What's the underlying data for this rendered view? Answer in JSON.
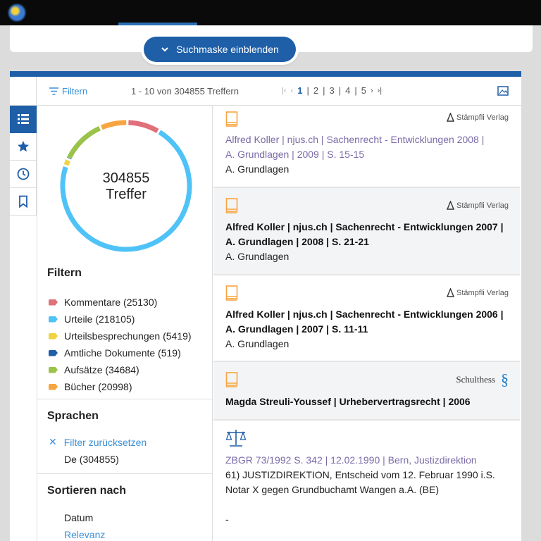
{
  "search_toggle": {
    "label": "Suchmaske einblenden"
  },
  "toolbar": {
    "filter_label": "Filtern",
    "hits_range": "1 - 10 von 304855 Treffern",
    "pages": [
      "1",
      "2",
      "3",
      "4",
      "5"
    ],
    "current_page": "1"
  },
  "summary": {
    "count": "304855",
    "count_label": "Treffer"
  },
  "filters": {
    "title": "Filtern",
    "items": [
      {
        "label": "Kommentare (25130)",
        "color": "#e0707a",
        "value": 25130
      },
      {
        "label": "Urteile (218105)",
        "color": "#4fc3f7",
        "value": 218105
      },
      {
        "label": "Urteilsbesprechungen (5419)",
        "color": "#f0d340",
        "value": 5419
      },
      {
        "label": "Amtliche Dokumente (519)",
        "color": "#1f5fa8",
        "value": 519
      },
      {
        "label": "Aufsätze (34684)",
        "color": "#9bc34a",
        "value": 34684
      },
      {
        "label": "Bücher (20998)",
        "color": "#f7a540",
        "value": 20998
      }
    ]
  },
  "languages": {
    "title": "Sprachen",
    "reset_label": "Filter zurücksetzen",
    "value": "De (304855)"
  },
  "sort": {
    "title": "Sortieren nach",
    "options": [
      "Datum",
      "Relevanz"
    ]
  },
  "results": [
    {
      "type": "book",
      "publisher": "Stämpfli Verlag",
      "title_line1": "Alfred Koller | njus.ch | Sachenrecht - Entwicklungen 2008 |",
      "title_line2": "A. Grundlagen | 2009 | S. 15-15",
      "subtitle": "A. Grundlagen"
    },
    {
      "type": "book",
      "publisher": "Stämpfli Verlag",
      "title_line1": "Alfred Koller | njus.ch | Sachenrecht - Entwicklungen 2007 |",
      "title_line2": "A. Grundlagen | 2008 | S. 21-21",
      "subtitle": "A. Grundlagen"
    },
    {
      "type": "book",
      "publisher": "Stämpfli Verlag",
      "title_line1": "Alfred Koller | njus.ch | Sachenrecht - Entwicklungen 2006 |",
      "title_line2": "A. Grundlagen | 2007 | S. 11-11",
      "subtitle": "A. Grundlagen"
    },
    {
      "type": "book",
      "publisher": "Schulthess",
      "publisher_mark": "§",
      "title_line1": "Magda Streuli-Youssef | Urhebervertragsrecht | 2006"
    },
    {
      "type": "ruling",
      "title_line1": "ZBGR 73/1992 S. 342 | 12.02.1990 | Bern, Justizdirektion",
      "text_line1": "61) JUSTIZDIREKTION, Entscheid vom 12. Februar 1990 i.S.",
      "text_line2": "Notar X gegen Grundbuchamt Wangen a.A. (BE)",
      "text_line3": "-"
    }
  ]
}
